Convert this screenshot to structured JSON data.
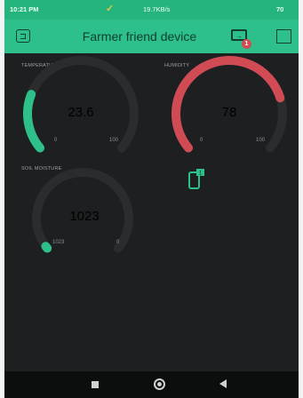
{
  "status_bar": {
    "time": "10:21 PM",
    "speed": "19.7KB/s",
    "battery": "70"
  },
  "app_bar": {
    "title": "Farmer friend device",
    "badge_count": "1"
  },
  "colors": {
    "accent": "#2ec08a",
    "temperature_arc": "#2ec08a",
    "humidity_arc": "#d14b55",
    "soil_arc": "#2ec08a",
    "track": "#2a2c2d",
    "background": "#1d1f20"
  },
  "widgets": {
    "temperature": {
      "label": "TEMPERATURE",
      "value": "23.6",
      "min": "0",
      "max": "100",
      "min_num": 0,
      "max_num": 100,
      "value_num": 23.6
    },
    "humidity": {
      "label": "HUMIDITY",
      "value": "78",
      "min": "0",
      "max": "100",
      "min_num": 0,
      "max_num": 100,
      "value_num": 78
    },
    "soil_moisture": {
      "label": "SOIL MOISTURE",
      "value": "1023",
      "min": "1023",
      "max": "0",
      "min_num": 1023,
      "max_num": 0,
      "value_num": 1023
    }
  },
  "icons": {
    "app_left": "device-square-icon",
    "device": "device-connect-icon",
    "square": "square-menu-icon",
    "phone": "phone-notification-icon"
  }
}
